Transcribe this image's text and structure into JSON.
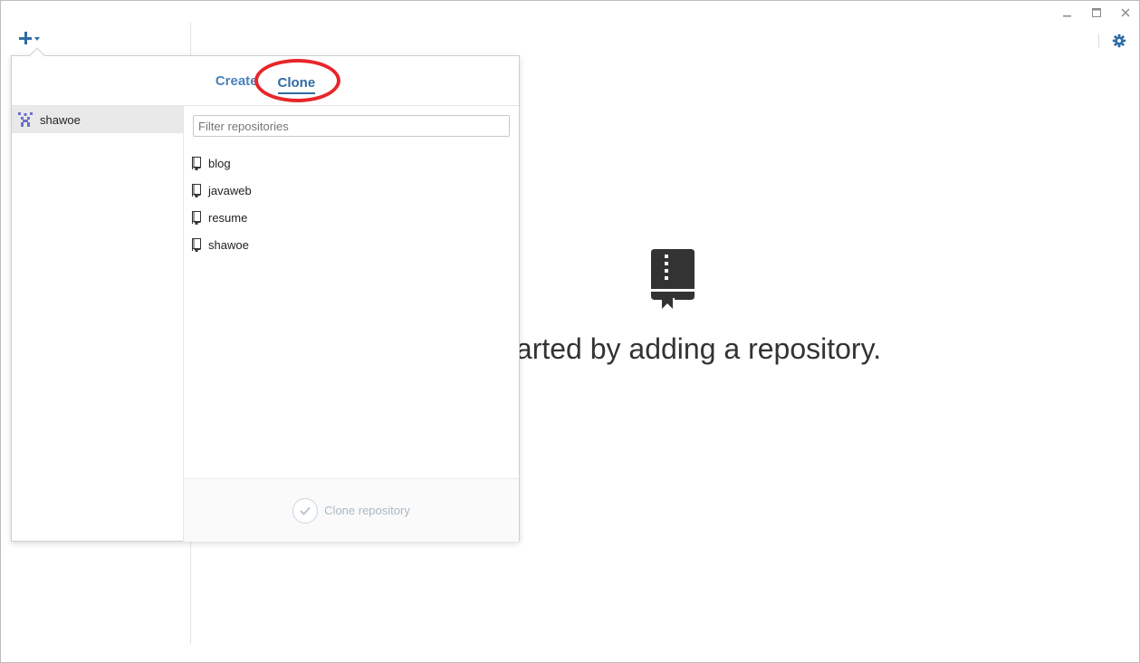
{
  "window": {
    "controls": [
      "minimize",
      "maximize",
      "close"
    ]
  },
  "toolbar": {
    "add_icon": "plus-icon",
    "settings_icon": "gear-icon"
  },
  "empty_state": {
    "icon": "repository-book-icon",
    "text": "tarted by adding a repository."
  },
  "popover": {
    "tabs": [
      {
        "label": "Create",
        "active": false
      },
      {
        "label": "Clone",
        "active": true
      }
    ],
    "accounts": [
      {
        "name": "shawoe",
        "selected": true
      }
    ],
    "filter": {
      "placeholder": "Filter repositories",
      "value": ""
    },
    "repositories": [
      "blog",
      "javaweb",
      "resume",
      "shawoe"
    ],
    "clone_button": "Clone repository"
  },
  "colors": {
    "accent": "#2e6ca4",
    "highlight_ring": "#e8262a",
    "disabled_text": "#a9b8c6"
  }
}
